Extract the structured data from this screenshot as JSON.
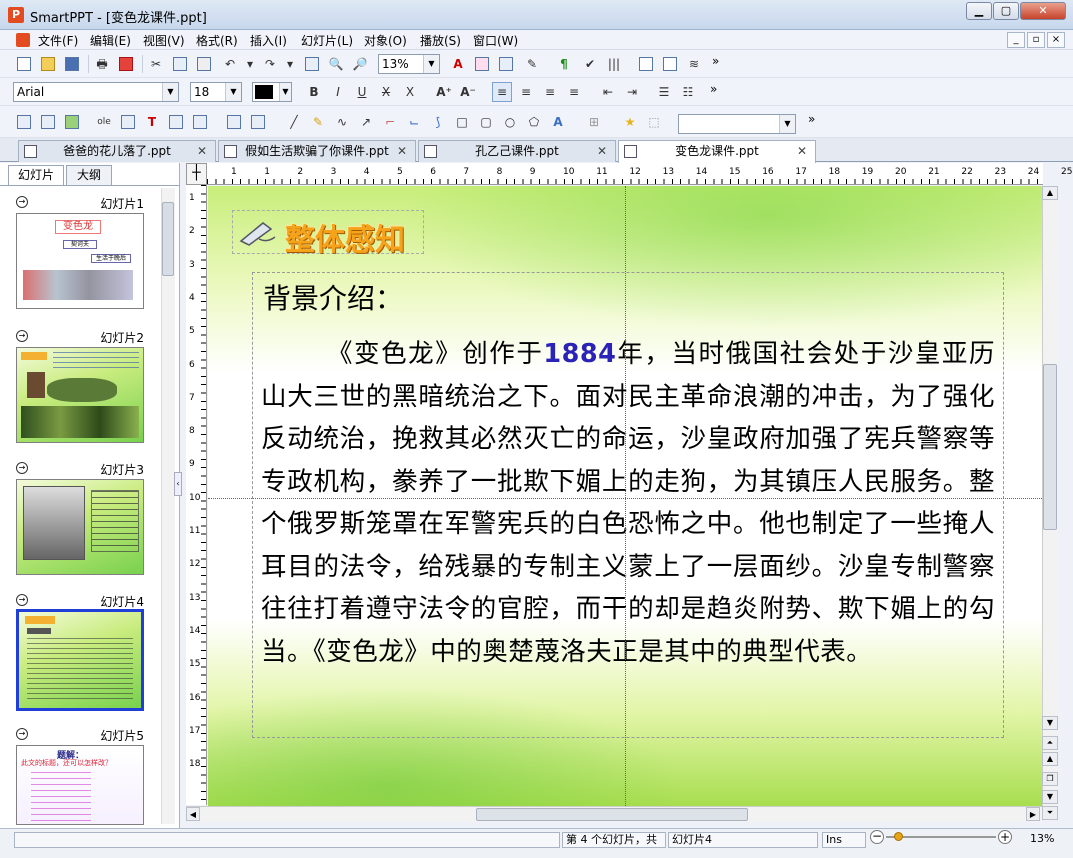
{
  "window": {
    "title": "SmartPPT - [变色龙课件.ppt]",
    "app_icon": "P"
  },
  "menu": [
    "文件(F)",
    "编辑(E)",
    "视图(V)",
    "格式(R)",
    "插入(I)",
    "幻灯片(L)",
    "对象(O)",
    "播放(S)",
    "窗口(W)"
  ],
  "toolbar": {
    "zoom": "13%",
    "font": "Arial",
    "font_size": "18",
    "color": "#000000",
    "more": "»"
  },
  "tabs": [
    {
      "label": "爸爸的花儿落了.ppt"
    },
    {
      "label": "假如生活欺骗了你课件.ppt"
    },
    {
      "label": "孔乙己课件.ppt"
    },
    {
      "label": "变色龙课件.ppt",
      "active": true
    }
  ],
  "left_tabs": [
    "幻灯片",
    "大纲"
  ],
  "slides": [
    {
      "label": "幻灯片1"
    },
    {
      "label": "幻灯片2"
    },
    {
      "label": "幻灯片3"
    },
    {
      "label": "幻灯片4",
      "selected": true
    },
    {
      "label": "幻灯片5"
    }
  ],
  "ruler": {
    "h": [
      "1",
      "1",
      "2",
      "3",
      "4",
      "5",
      "6",
      "7",
      "8",
      "9",
      "10",
      "11",
      "12",
      "13",
      "14",
      "15",
      "16",
      "17",
      "18",
      "19",
      "20",
      "21",
      "22",
      "23",
      "24",
      "25"
    ],
    "v": [
      "1",
      "2",
      "3",
      "4",
      "5",
      "6",
      "7",
      "8",
      "9",
      "10",
      "11",
      "12",
      "13",
      "14",
      "15",
      "16",
      "17",
      "18"
    ]
  },
  "slide": {
    "title": "整体感知",
    "heading": "背景介绍：",
    "body_pre": "《变色龙》创作于",
    "body_year": "1884",
    "body_post": "年，当时俄国社会处于沙皇亚历山大三世的黑暗统治之下。面对民主革命浪潮的冲击，为了强化反动统治，挽救其必然灭亡的命运，沙皇政府加强了宪兵警察等专政机构，豢养了一批欺下媚上的走狗，为其镇压人民服务。整个俄罗斯笼罩在军警宪兵的白色恐怖之中。他也制定了一些掩人耳目的法令，给残暴的专制主义蒙上了一层面纱。沙皇专制警察往往打着遵守法令的官腔，而干的却是趋炎附势、欺下媚上的勾当。《变色龙》中的奥楚蔑洛夫正是其中的典型代表。"
  },
  "thumbs": {
    "s1_title": "变色龙",
    "s1_a": "契诃夫",
    "s1_b": "生活于晚后",
    "s5_head": "题解：",
    "s5_sub": "此文的标题，还可以怎样改？"
  },
  "status": {
    "slide_info": "第 4 个幻灯片，共",
    "slide_name": "幻灯片4",
    "mode": "Ins",
    "zoom": "13%"
  }
}
